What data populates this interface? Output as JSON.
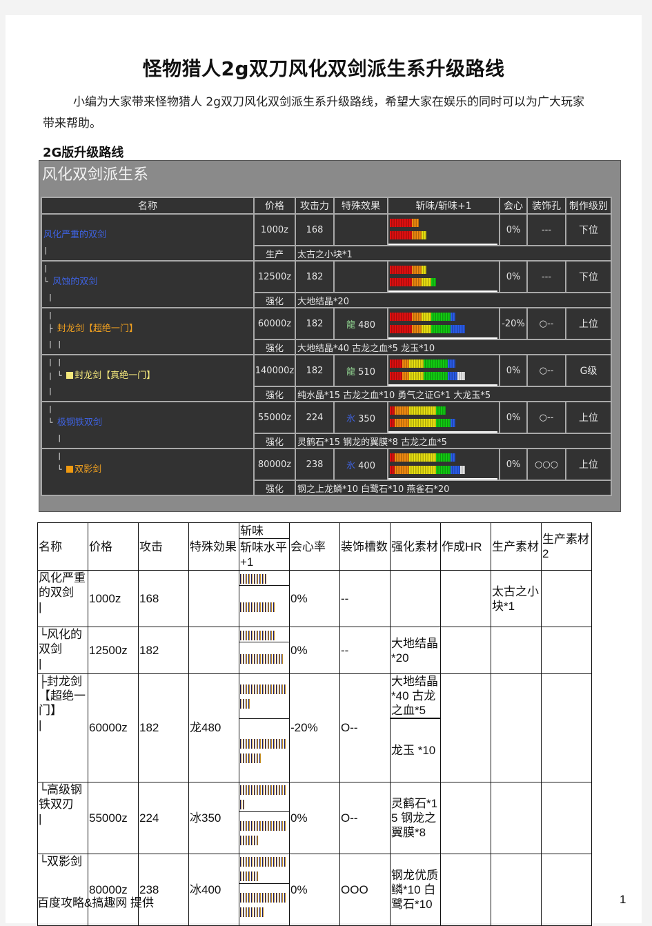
{
  "document": {
    "title": "怪物猎人2g双刀风化双剑派生系升级路线",
    "intro": "小编为大家带来怪物猎人 2g双刀风化双剑派生系升级路线，希望大家在娱乐的同时可以为广大玩家带来帮助。",
    "section_heading": "2G版升级路线",
    "footer_left": "百度攻略&搞趣网 提供",
    "page_number": "1"
  },
  "game_table": {
    "title": "风化双剑派生系",
    "headers": [
      "名称",
      "价格",
      "攻击力",
      "特殊效果",
      "斩味/斩味+1",
      "会心",
      "装饰孔",
      "制作级别"
    ],
    "rows": [
      {
        "tree_top": "",
        "tree_prefix": "",
        "name": "风化严重的双剑",
        "name_color": "blue",
        "name_marker": "",
        "tree_bottom": "|",
        "price": "1000z",
        "attack": "168",
        "element_label": "",
        "element_value": "",
        "sharpness": [
          {
            "red": 9,
            "orange": 3
          },
          {
            "red": 9,
            "orange": 4,
            "yellow": 2
          }
        ],
        "affinity": "0%",
        "affinity_negative": false,
        "slots": "---",
        "rank": "下位",
        "material_label": "生产",
        "material_label_type": "produce",
        "materials": "太古之小块*1"
      },
      {
        "tree_top": "|",
        "tree_prefix": "└ ",
        "name": "风蚀的双剑",
        "name_color": "blue",
        "name_marker": "",
        "tree_bottom": " |",
        "price": "12500z",
        "attack": "182",
        "element_label": "",
        "element_value": "",
        "sharpness": [
          {
            "red": 9,
            "orange": 4,
            "yellow": 2
          },
          {
            "red": 9,
            "orange": 4,
            "yellow": 4,
            "green": 2
          }
        ],
        "affinity": "0%",
        "affinity_negative": false,
        "slots": "---",
        "rank": "下位",
        "material_label": "强化",
        "material_label_type": "upgrade",
        "materials": "大地结晶*20"
      },
      {
        "tree_top": " |",
        "tree_prefix": " ├ ",
        "name": "封龙剑【超绝一门】",
        "name_color": "orange",
        "name_marker": "",
        "tree_bottom": " | |",
        "price": "60000z",
        "attack": "182",
        "element_label": "龍",
        "element_value": "480",
        "element_type": "dragon",
        "sharpness": [
          {
            "red": 9,
            "orange": 4,
            "yellow": 4,
            "green": 8,
            "blue": 2
          },
          {
            "red": 9,
            "orange": 4,
            "yellow": 4,
            "green": 8,
            "blue": 6
          }
        ],
        "affinity": "-20%",
        "affinity_negative": true,
        "slots": "○--",
        "rank": "上位",
        "material_label": "强化",
        "material_label_type": "upgrade",
        "materials": "大地结晶*40 古龙之血*5 龙玉*10"
      },
      {
        "tree_top": " | |",
        "tree_prefix": " | └ ",
        "name": "封龙剑【真绝一门】",
        "name_color": "yellow",
        "name_marker": "#f4e87c",
        "tree_bottom": " |",
        "price": "140000z",
        "attack": "182",
        "element_label": "龍",
        "element_value": "510",
        "element_type": "dragon",
        "sharpness": [
          {
            "red": 5,
            "orange": 3,
            "yellow": 6,
            "green": 10,
            "blue": 3
          },
          {
            "red": 5,
            "orange": 3,
            "yellow": 6,
            "green": 10,
            "blue": 4,
            "white": 3
          }
        ],
        "affinity": "0%",
        "affinity_negative": false,
        "slots": "○--",
        "rank": "G级",
        "material_label": "强化",
        "material_label_type": "upgrade",
        "materials": "纯水晶*15 古龙之血*10 勇气之证G*1 大龙玉*5"
      },
      {
        "tree_top": " |",
        "tree_prefix": " └ ",
        "name": "极钢铁双剑",
        "name_color": "blue",
        "name_marker": "",
        "tree_bottom": "   |",
        "price": "55000z",
        "attack": "224",
        "element_label": "氷",
        "element_value": "350",
        "element_type": "ice",
        "sharpness": [
          {
            "red": 2,
            "orange": 6,
            "yellow": 11,
            "green": 4
          },
          {
            "red": 2,
            "orange": 6,
            "yellow": 11,
            "green": 6,
            "blue": 2
          }
        ],
        "affinity": "0%",
        "affinity_negative": false,
        "slots": "○--",
        "rank": "上位",
        "material_label": "强化",
        "material_label_type": "upgrade",
        "materials": "灵鹤石*15 钢龙的翼膜*8 古龙之血*5"
      },
      {
        "tree_top": "   |",
        "tree_prefix": "   └ ",
        "name": "双影剑",
        "name_color": "orange",
        "name_marker": "#f09a10",
        "tree_bottom": "",
        "price": "80000z",
        "attack": "238",
        "element_label": "氷",
        "element_value": "400",
        "element_type": "ice",
        "sharpness": [
          {
            "red": 2,
            "orange": 6,
            "yellow": 11,
            "green": 6,
            "blue": 2
          },
          {
            "red": 2,
            "orange": 6,
            "yellow": 11,
            "green": 6,
            "blue": 4,
            "white": 2
          }
        ],
        "affinity": "0%",
        "affinity_negative": false,
        "slots": "○○○",
        "rank": "上位",
        "material_label": "强化",
        "material_label_type": "upgrade",
        "materials": "钢之上龙鳞*10 白鹭石*10 燕雀石*20"
      }
    ],
    "sharpness_colors": {
      "red": "#e01010",
      "orange": "#f08a10",
      "yellow": "#e8e010",
      "green": "#12cc12",
      "blue": "#2a5ce8",
      "white": "#e8e8e8"
    }
  },
  "text_table": {
    "headers": {
      "name": "名称",
      "price": "价格",
      "attack": "攻击",
      "special": "特殊効果",
      "sharpness": "斩味",
      "sharpness_plus": "斩味水平+1",
      "affinity": "会心率",
      "slots": "装饰槽数",
      "upgrade": "强化素材",
      "hr": "作成HR",
      "produce1": "生产素材",
      "produce2": "生产素材2"
    },
    "rows": [
      {
        "name": "风化严重的双剑\n|",
        "price": "1000z",
        "attack": "168",
        "special": "",
        "sharp_ticks": 10,
        "sharp_plus_ticks": 13,
        "affinity": "0%",
        "slots": "--",
        "upgrade": "",
        "upgrade2": "",
        "hr": "",
        "produce1": "太古之小块*1",
        "produce2": ""
      },
      {
        "name": "└风化的双剑\n|",
        "price": "12500z",
        "attack": "182",
        "special": "",
        "sharp_ticks": 13,
        "sharp_plus_ticks": 16,
        "affinity": "0%",
        "slots": "--",
        "upgrade": "大地结晶*20",
        "upgrade2": "",
        "hr": "",
        "produce1": "",
        "produce2": ""
      },
      {
        "name": "├封龙剑【超绝一门】\n|",
        "price": "60000z",
        "attack": "182",
        "special": "龙480",
        "sharp_ticks": 21,
        "sharp_plus_ticks": 25,
        "affinity": "-20%",
        "slots": "O--",
        "upgrade": "大地结晶*40 古龙之血*5",
        "upgrade2": "龙玉 *10",
        "hr": "",
        "produce1": "",
        "produce2": ""
      },
      {
        "name": "└高级钢铁双刃\n|",
        "price": "55000z",
        "attack": "224",
        "special": "冰350",
        "sharp_ticks": 19,
        "sharp_plus_ticks": 24,
        "affinity": "0%",
        "slots": "O--",
        "upgrade": "灵鹤石*15 钢龙之翼膜*8",
        "upgrade2": "",
        "hr": "",
        "produce1": "",
        "produce2": ""
      },
      {
        "name": "└双影剑",
        "price": "80000z",
        "attack": "238",
        "special": "冰400",
        "sharp_ticks": 24,
        "sharp_plus_ticks": 26,
        "affinity": "0%",
        "slots": "OOO",
        "upgrade": "钢龙优质鳞*10 白鹭石*10",
        "upgrade2": "",
        "hr": "",
        "produce1": "",
        "produce2": ""
      }
    ]
  }
}
